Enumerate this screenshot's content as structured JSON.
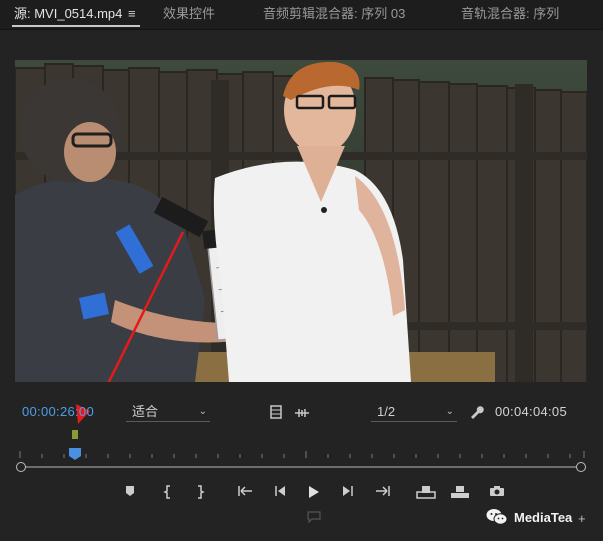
{
  "tabs": [
    {
      "label": "源: MVI_0514.mp4",
      "active": true
    },
    {
      "label": "效果控件",
      "active": false
    },
    {
      "label": "音频剪辑混合器: 序列 03",
      "active": false
    },
    {
      "label": "音轨混合器: 序列"
    }
  ],
  "tab_menu_glyph": "≡",
  "controls": {
    "current_timecode": "00:00:26:00",
    "fit_dropdown": "适合",
    "resolution_dropdown": "1/2",
    "duration_timecode": "00:04:04:05"
  },
  "transport_icons": [
    "add-marker-icon",
    "mark-in-icon",
    "mark-out-icon",
    "go-to-in-icon",
    "step-back-icon",
    "play-icon",
    "step-forward-icon",
    "go-to-out-icon",
    "insert-icon",
    "overwrite-icon",
    "export-frame-icon"
  ],
  "watermark": {
    "text": "MediaTea"
  },
  "colors": {
    "timecode_blue": "#4f9ee8",
    "annotation_arrow": "#e31b1b",
    "in_marker": "#8c9a34",
    "playhead": "#4a8fe0"
  }
}
